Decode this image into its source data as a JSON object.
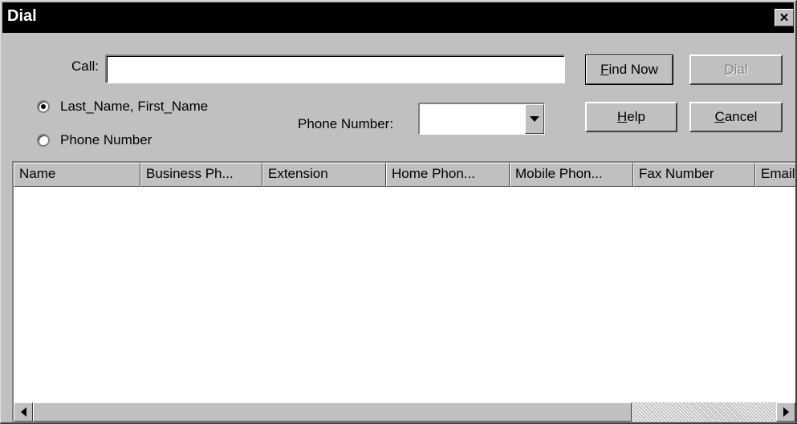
{
  "window": {
    "title": "Dial",
    "close_glyph": "✕"
  },
  "call": {
    "label": "Call:",
    "value": ""
  },
  "buttons": {
    "find_now_prefix": "",
    "find_now_mnemonic": "F",
    "find_now_suffix": "ind Now",
    "dial_prefix": "",
    "dial_mnemonic": "D",
    "dial_suffix": "ial",
    "help_prefix": "",
    "help_mnemonic": "H",
    "help_suffix": "elp",
    "cancel_prefix": "",
    "cancel_mnemonic": "C",
    "cancel_suffix": "ancel"
  },
  "radios": [
    {
      "label": "Last_Name, First_Name",
      "checked": true
    },
    {
      "label": "Phone Number",
      "checked": false
    }
  ],
  "phone_number": {
    "label": "Phone Number:",
    "value": ""
  },
  "columns": [
    "Name",
    "Business Ph...",
    "Extension",
    "Home Phon...",
    "Mobile Phon...",
    "Fax Number",
    "Email"
  ],
  "rows": [],
  "icons": {
    "close": "close-icon",
    "dropdown": "dropdown-arrow-icon",
    "scroll_left": "scroll-left-icon",
    "scroll_right": "scroll-right-icon"
  }
}
